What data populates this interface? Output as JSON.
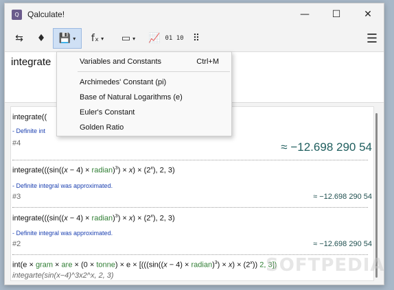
{
  "window": {
    "title": "Qalculate!",
    "app_icon_glyph": "Q",
    "min_glyph": "—",
    "max_glyph": "☐",
    "close_glyph": "✕"
  },
  "toolbar": {
    "mode_icon": "⇆",
    "store_icon": "♦",
    "save_icon": "💾",
    "functions_icon": "fₓ",
    "units_icon": "▭",
    "plot_icon": "📈",
    "number_bases_icon": "01 10",
    "keypad_icon": "⠿",
    "menu_icon": "☰",
    "caret": "▾"
  },
  "expression": {
    "text": "integrate"
  },
  "history": {
    "entry4": {
      "expr_prefix": "integrate((",
      "note": "- Definite int",
      "index": "#4",
      "result": "≈ −12.698 290 54"
    },
    "entry3": {
      "expr_a": "integrate(((sin((",
      "var_x": "x",
      "expr_b": " − 4) × ",
      "unit": "radian",
      "expr_c": ")",
      "sup3": "3",
      "expr_d": ") × ",
      "expr_e": ") × (2",
      "supx": "x",
      "expr_f": "), 2, 3)",
      "note": "- Definite integral was approximated.",
      "index": "#3",
      "result": "≈ −12.698 290 54"
    },
    "entry2": {
      "expr_a": "integrate(((sin((",
      "var_x": "x",
      "expr_b": " − 4) × ",
      "unit": "radian",
      "expr_c": ")",
      "sup3": "3",
      "expr_d": ") × ",
      "expr_e": ") × (2",
      "supx": "x",
      "expr_f": "), 2, 3)",
      "note": "- Definite integral was approximated.",
      "index": "#2",
      "result": "≈ −12.698 290 54"
    },
    "entry1": {
      "expr_a": "int(e × ",
      "unit_gram": "gram",
      "expr_b": " × ",
      "unit_are": "are",
      "expr_c": " × (0 × ",
      "unit_tonne": "tonne",
      "expr_d": ") × e × [(((sin((",
      "var_x": "x",
      "expr_e": " − 4) × ",
      "unit_radian": "radian",
      "expr_f": ")",
      "sup3": "3",
      "expr_g": ") × ",
      "var_x2": "x",
      "expr_h": ") × (2",
      "supx": "x",
      "expr_i": ")) ",
      "expr_j": "2, 3])",
      "input": "integarte(sin(x−4)^3x2^x, 2, 3)"
    }
  },
  "menu": {
    "items": [
      {
        "label": "Variables and Constants",
        "shortcut": "Ctrl+M"
      },
      {
        "label": "Archimedes' Constant (pi)"
      },
      {
        "label": "Base of Natural Logarithms (e)"
      },
      {
        "label": "Euler's Constant"
      },
      {
        "label": "Golden Ratio"
      }
    ]
  },
  "watermark": "SOFTPEDIA"
}
